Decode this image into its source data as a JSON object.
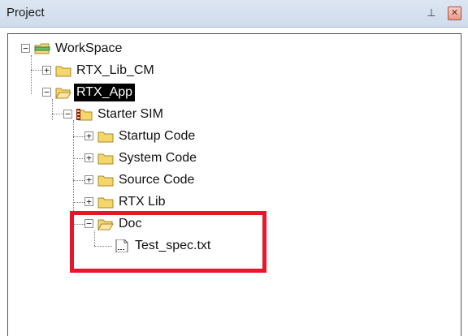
{
  "panel": {
    "title": "Project",
    "pin_glyph": "⊥",
    "close_glyph": "✕",
    "pin_icon": "pin-icon",
    "close_icon": "close-icon"
  },
  "tree": {
    "workspace": "WorkSpace",
    "rtx_lib_cm": "RTX_Lib_CM",
    "rtx_app": "RTX_App",
    "starter_sim": "Starter SIM",
    "startup_code": "Startup Code",
    "system_code": "System Code",
    "source_code": "Source Code",
    "rtx_lib": "RTX Lib",
    "doc": "Doc",
    "test_spec": "Test_spec.txt"
  },
  "expander_glyphs": {
    "expanded": "−",
    "collapsed": "+"
  },
  "colors": {
    "highlight_border": "#e8162a",
    "selected_bg": "#000000",
    "folder_fill": "#f5d66a",
    "titlebar": "#d6e1ef"
  }
}
